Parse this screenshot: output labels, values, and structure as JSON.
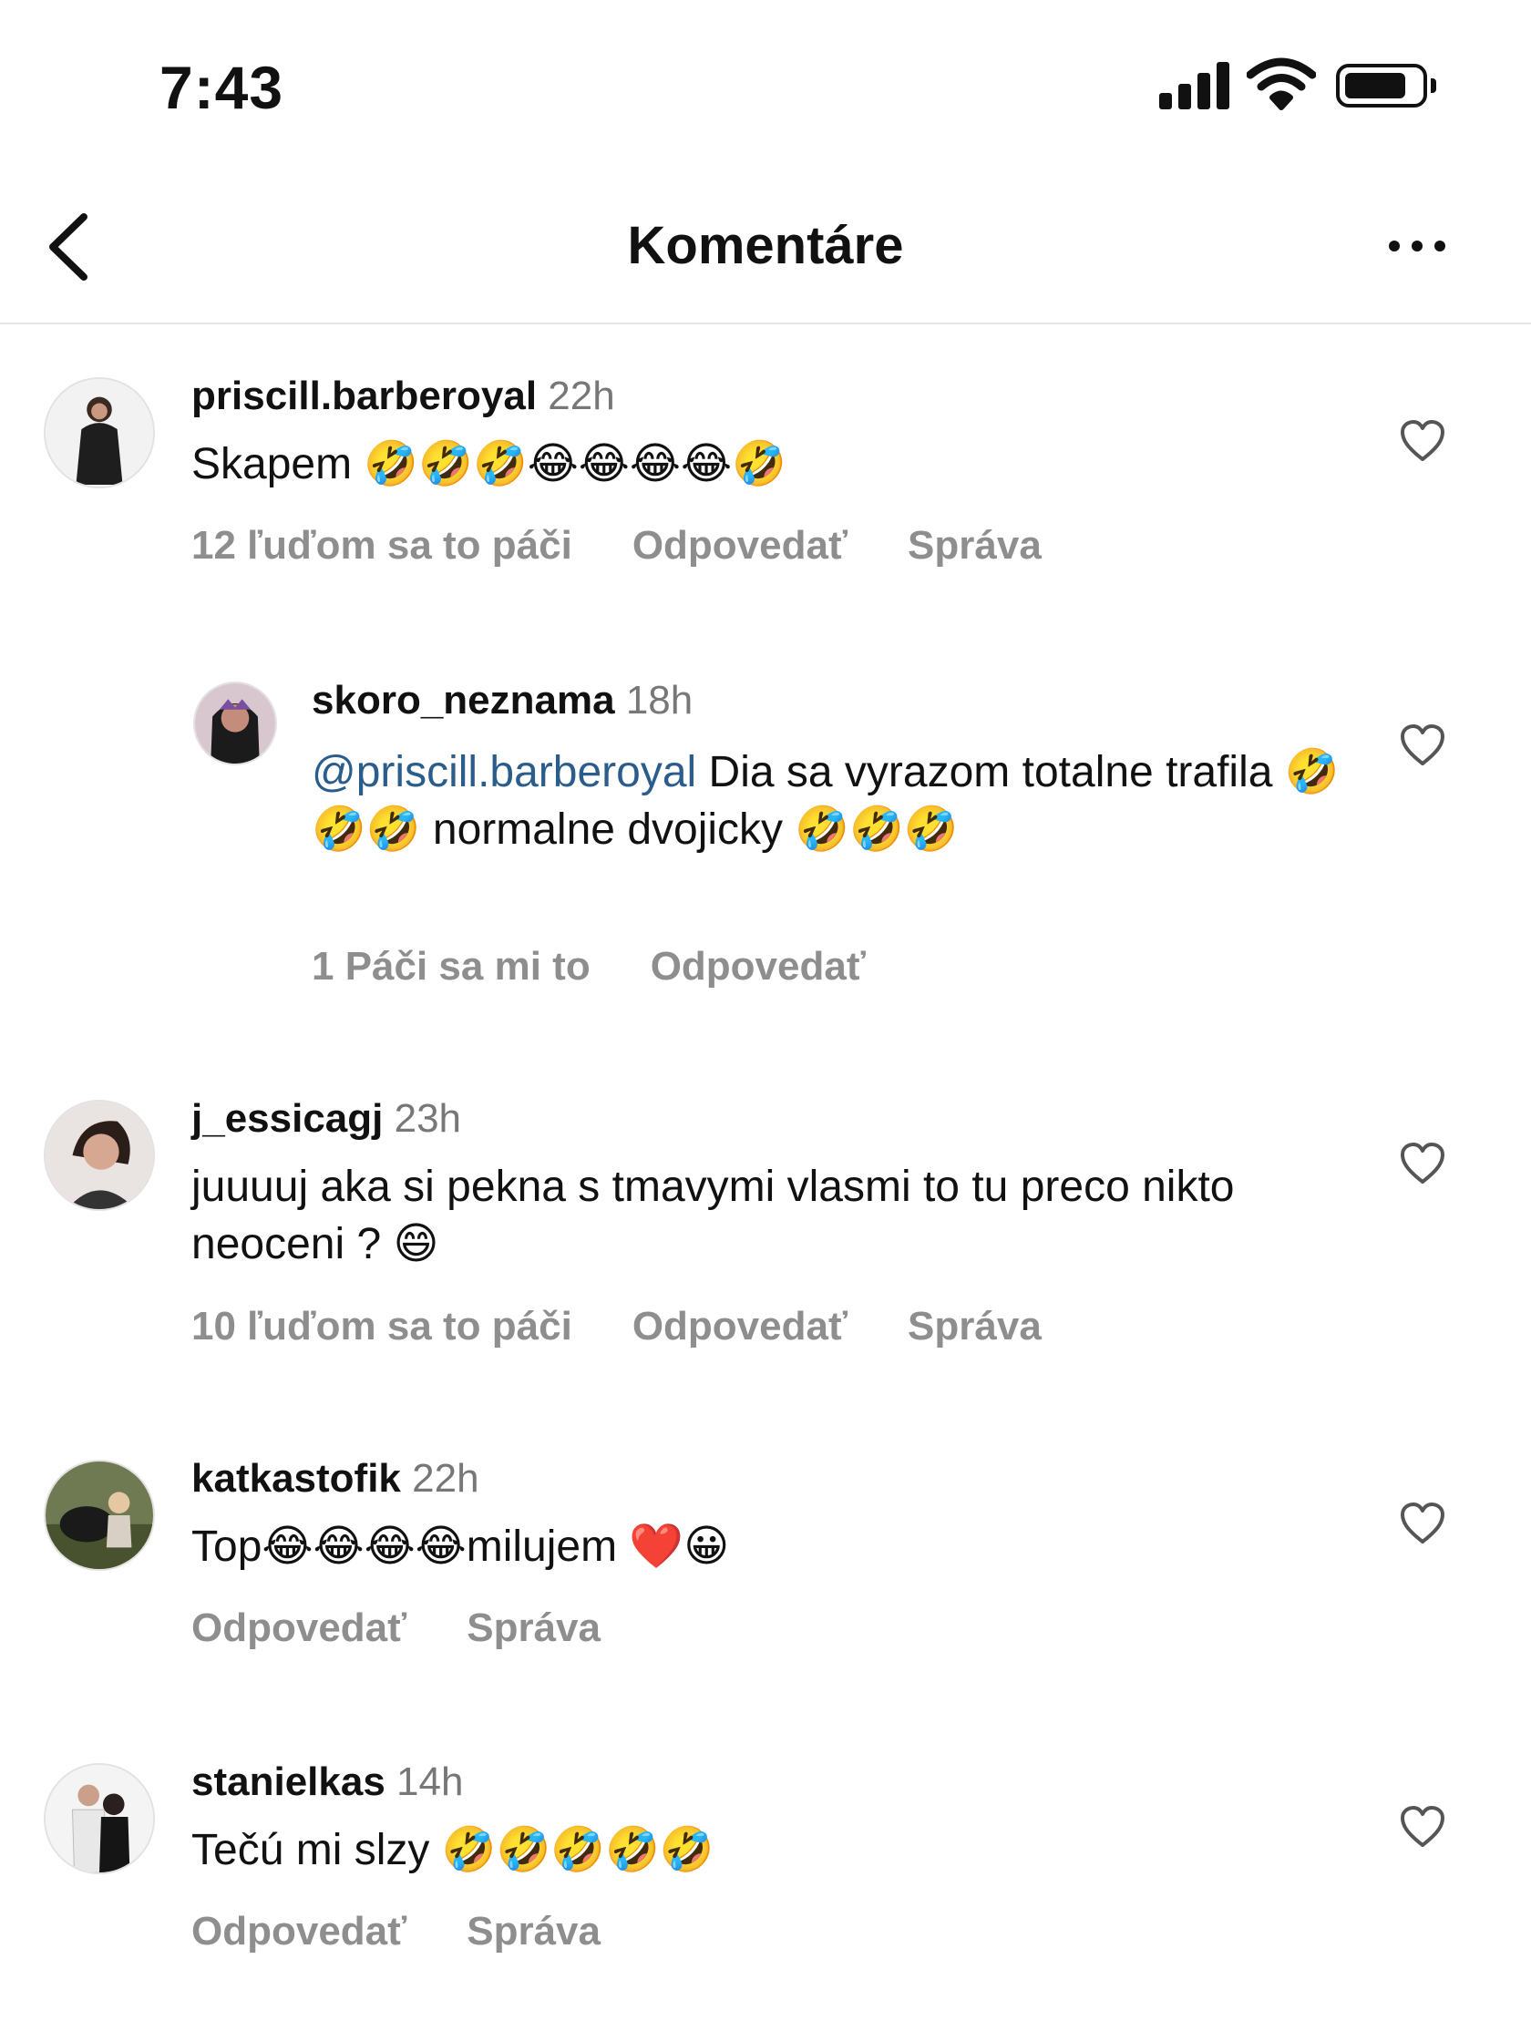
{
  "status_bar": {
    "time": "7:43"
  },
  "header": {
    "title": "Komentáre"
  },
  "comments": [
    {
      "username": "priscill.barberoyal",
      "time": "22h",
      "text": "Skapem 🤣🤣🤣😂😂😂😂🤣",
      "likes": "12 ľuďom sa to páči",
      "reply": "Odpovedať",
      "message": "Správa"
    },
    {
      "username": "skoro_neznama",
      "time": "18h",
      "mention": "@priscill.barberoyal",
      "text": " Dia sa vyrazom totalne trafila 🤣🤣🤣 normalne dvojicky 🤣🤣🤣",
      "likes": "1 Páči sa mi to",
      "reply": "Odpovedať"
    },
    {
      "username": "j_essicagj",
      "time": "23h",
      "text": "juuuuj aka si pekna s tmavymi vlasmi to tu preco nikto neoceni ? 😄",
      "likes": "10 ľuďom sa to páči",
      "reply": "Odpovedať",
      "message": "Správa"
    },
    {
      "username": "katkastofik",
      "time": "22h",
      "text": "Top😂😂😂😂milujem ❤️😀",
      "reply": "Odpovedať",
      "message": "Správa"
    },
    {
      "username": "stanielkas",
      "time": "14h",
      "text": "Tečú mi slzy 🤣🤣🤣🤣🤣",
      "reply": "Odpovedať",
      "message": "Správa"
    }
  ],
  "icons": {
    "back": "chevron-left-icon",
    "more": "more-horizontal-icon",
    "like": "heart-outline-icon",
    "signal": "cellular-signal-icon",
    "wifi": "wifi-icon",
    "battery": "battery-icon"
  },
  "colors": {
    "text": "#111111",
    "secondary": "#8e8e8e",
    "mention": "#2a5d8c",
    "divider": "#e6e6e6"
  }
}
